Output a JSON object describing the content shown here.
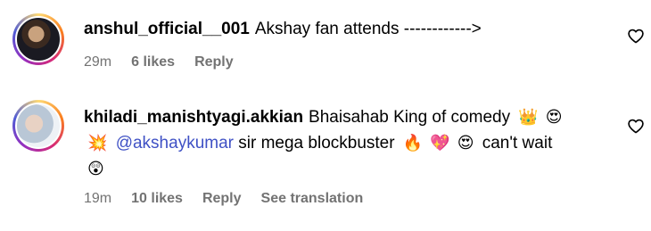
{
  "comments": [
    {
      "username": "anshul_official__001",
      "text": "Akshay fan attends ------------>",
      "time": "29m",
      "likes": "6 likes",
      "reply": "Reply"
    },
    {
      "username": "khiladi_manishtyagi.akkian",
      "text_part1": "Bhaisahab King of comedy",
      "emoji_crown": "👑",
      "emoji_hearteyes": "😍",
      "emoji_collision": "💥",
      "mention": "@akshaykumar",
      "text_part2": "sir mega blockbuster",
      "emoji_fire": "🔥",
      "emoji_heart": "💖",
      "emoji_hearteyes2": "😍",
      "text_part3": "can't wait",
      "emoji_astonished": "😲",
      "time": "19m",
      "likes": "10 likes",
      "reply": "Reply",
      "translation": "See translation"
    }
  ],
  "icons": {
    "like": "heart-outline-icon"
  }
}
